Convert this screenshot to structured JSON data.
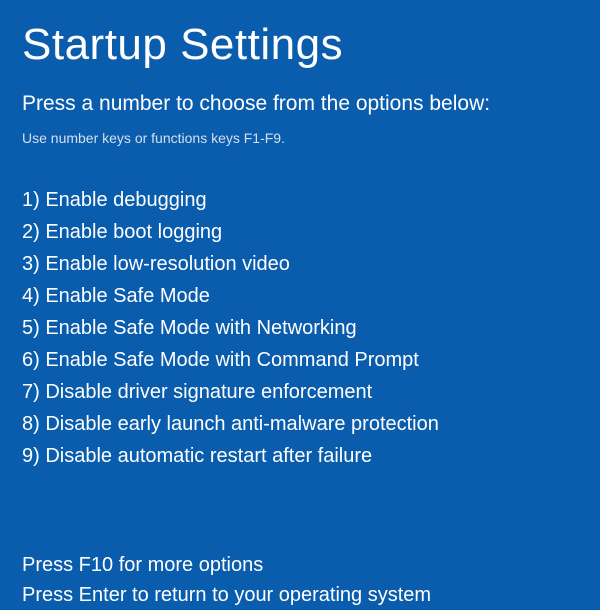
{
  "title": "Startup Settings",
  "subtitle": "Press a number to choose from the options below:",
  "hint": "Use number keys or functions keys F1-F9.",
  "options": [
    "1) Enable debugging",
    "2) Enable boot logging",
    "3) Enable low-resolution video",
    "4) Enable Safe Mode",
    "5) Enable Safe Mode with Networking",
    "6) Enable Safe Mode with Command Prompt",
    "7) Disable driver signature enforcement",
    "8) Disable early launch anti-malware protection",
    "9) Disable automatic restart after failure"
  ],
  "footer": {
    "more_options": "Press F10 for more options",
    "return_line": "Press Enter to return to your operating system"
  }
}
